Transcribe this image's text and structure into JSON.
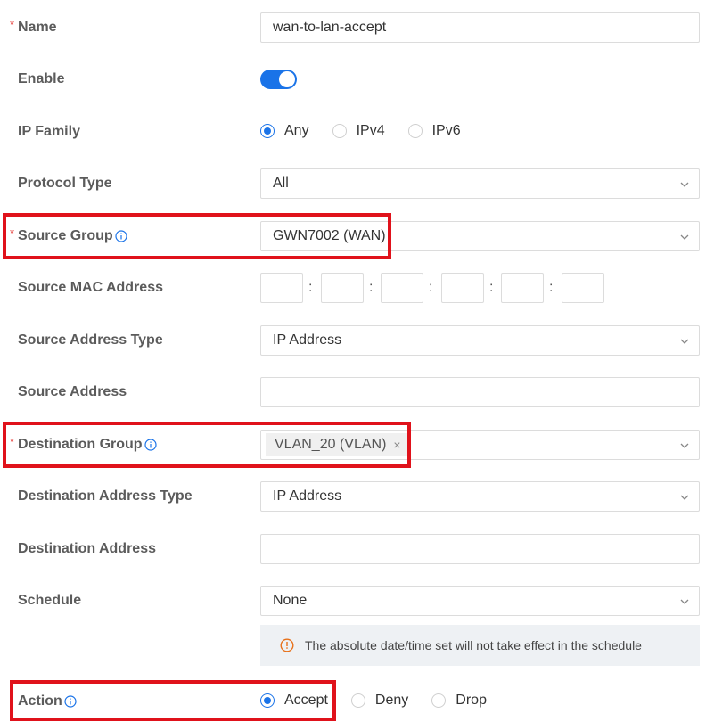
{
  "form": {
    "name": {
      "label": "Name",
      "value": "wan-to-lan-accept",
      "required": "*"
    },
    "enable": {
      "label": "Enable",
      "state": "on"
    },
    "ip_family": {
      "label": "IP Family",
      "options": [
        "Any",
        "IPv4",
        "IPv6"
      ],
      "selected": "Any"
    },
    "protocol_type": {
      "label": "Protocol Type",
      "value": "All"
    },
    "source_group": {
      "label": "Source Group",
      "value": "GWN7002 (WAN)",
      "required": "*"
    },
    "source_mac": {
      "label": "Source MAC Address",
      "separator": ":"
    },
    "source_address_type": {
      "label": "Source Address Type",
      "value": "IP Address"
    },
    "source_address": {
      "label": "Source Address",
      "value": ""
    },
    "destination_group": {
      "label": "Destination Group",
      "tag": "VLAN_20 (VLAN)",
      "tag_remove": "×",
      "required": "*"
    },
    "destination_address_type": {
      "label": "Destination Address Type",
      "value": "IP Address"
    },
    "destination_address": {
      "label": "Destination Address",
      "value": ""
    },
    "schedule": {
      "label": "Schedule",
      "value": "None",
      "note": "The absolute date/time set will not take effect in the schedule"
    },
    "action": {
      "label": "Action",
      "options": [
        "Accept",
        "Deny",
        "Drop"
      ],
      "selected": "Accept"
    }
  },
  "colors": {
    "accent": "#1a73e8",
    "required": "#e53935",
    "highlight": "#e0121b"
  },
  "icons": {
    "info": "info-circle-icon",
    "chevron": "chevron-down-icon",
    "warning": "warning-circle-icon",
    "remove": "close-icon"
  }
}
